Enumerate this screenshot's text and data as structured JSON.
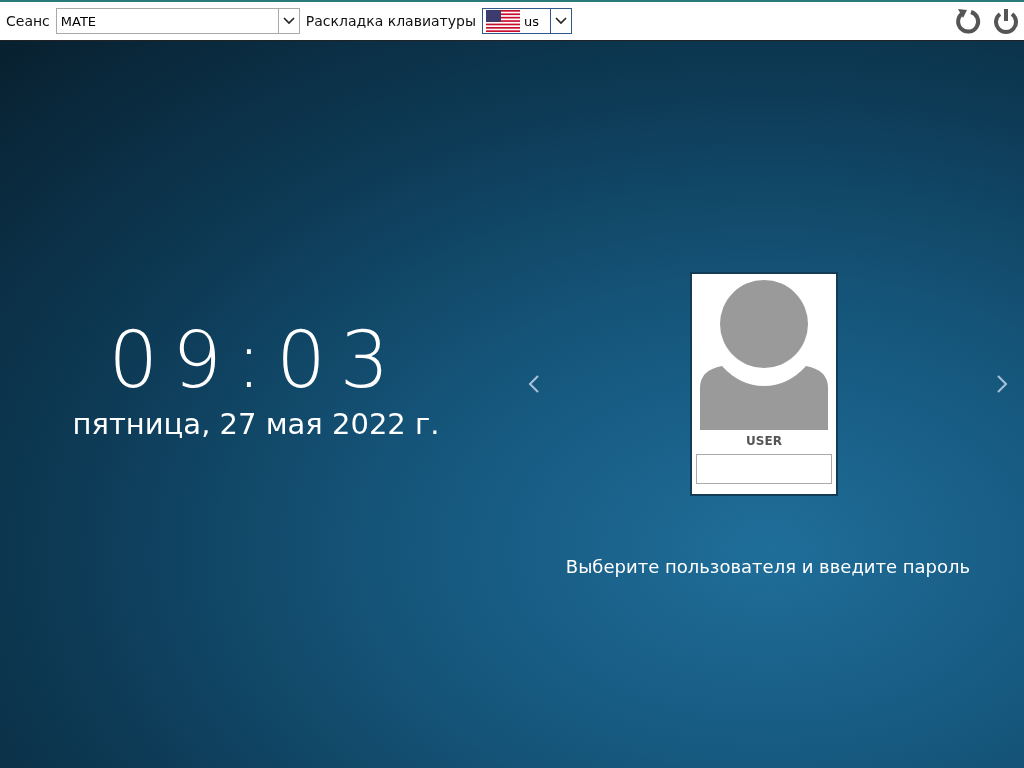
{
  "top_bar": {
    "session_label": "Сеанс",
    "session_value": "MATE",
    "layout_label": "Раскладка клавиатуры",
    "layout_value": "us"
  },
  "clock": {
    "time": "09:03",
    "date": "пятница, 27 мая 2022 г."
  },
  "user_card": {
    "name": "USER"
  },
  "prompt": "Выберите пользователя и введите пароль"
}
